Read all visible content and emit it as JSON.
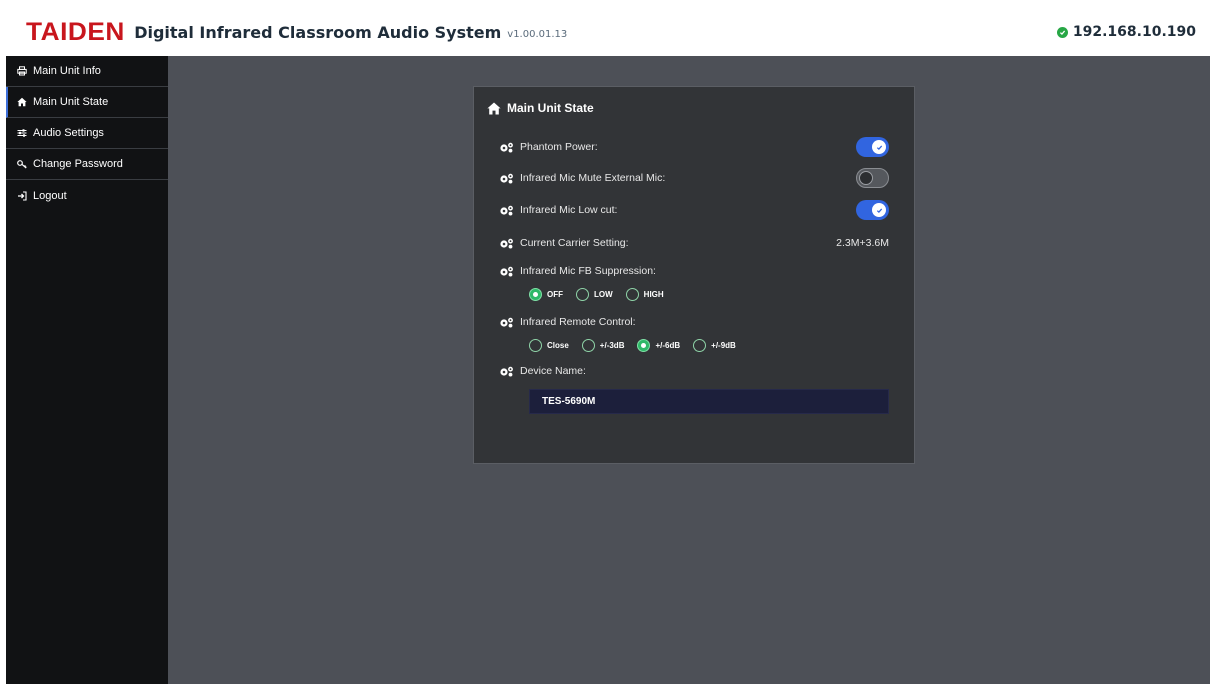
{
  "header": {
    "brand": "TAIDEN",
    "title": "Digital Infrared Classroom Audio System",
    "version": "v1.00.01.13",
    "ip": "192.168.10.190"
  },
  "sidebar": {
    "items": [
      {
        "label": "Main Unit Info",
        "icon": "printer-icon"
      },
      {
        "label": "Main Unit State",
        "icon": "home-icon"
      },
      {
        "label": "Audio Settings",
        "icon": "sliders-icon"
      },
      {
        "label": "Change Password",
        "icon": "key-icon"
      },
      {
        "label": "Logout",
        "icon": "logout-icon"
      }
    ],
    "active_index": 1
  },
  "panel": {
    "title": "Main Unit State",
    "phantom_power": {
      "label": "Phantom Power:",
      "on": true
    },
    "mute_external": {
      "label": "Infrared Mic Mute External Mic:",
      "on": false
    },
    "low_cut": {
      "label": "Infrared Mic Low cut:",
      "on": true
    },
    "carrier": {
      "label": "Current Carrier Setting:",
      "value": "2.3M+3.6M"
    },
    "fb_suppression": {
      "label": "Infrared Mic FB Suppression:",
      "options": [
        "OFF",
        "LOW",
        "HIGH"
      ],
      "selected": "OFF"
    },
    "remote_control": {
      "label": "Infrared Remote Control:",
      "options": [
        "Close",
        "+/-3dB",
        "+/-6dB",
        "+/-9dB"
      ],
      "selected": "+/-6dB"
    },
    "device_name": {
      "label": "Device Name:",
      "value": "TES-5690M"
    }
  },
  "colors": {
    "brand": "#c8161d",
    "accent": "#3165e0",
    "radio_selected": "#2fb868",
    "status_ok": "#27a745"
  }
}
